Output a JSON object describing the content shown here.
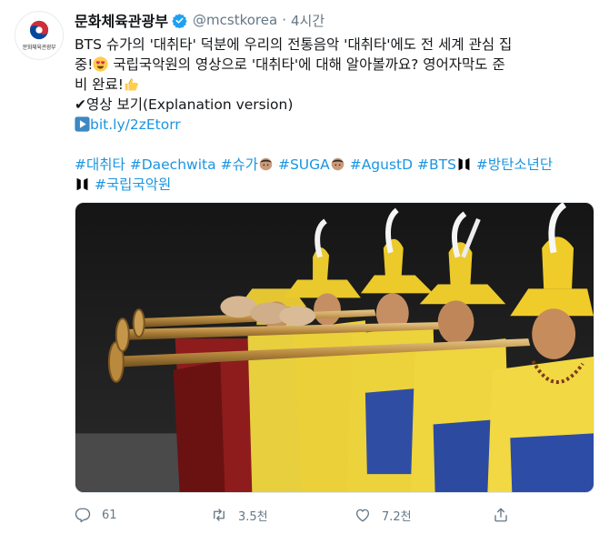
{
  "account": {
    "name": "문화체육관광부",
    "handle": "@mcstkorea",
    "separator": "·",
    "time": "4시간",
    "avatar_text": "문화체육관광부"
  },
  "tweet": {
    "line1": "BTS 슈가의 '대취타' 덕분에 우리의 전통음악 '대취타'에도 전 세계 관심 집",
    "line2a": "중!",
    "line2b": " 국립국악원의 영상으로 '대취타'에 대해 알아볼까요? 영어자막도 준",
    "line3": "비 완료!",
    "check_mark": "✔",
    "video_text": "영상 보기(Explanation version)",
    "link_text": "bit.ly/2zEtorr"
  },
  "hashtags": {
    "h1": "#대취타",
    "h2": "#Daechwita",
    "h3": "#슈가",
    "h4": "#SUGA",
    "h5": "#AgustD",
    "h6": "#BTS",
    "h7": "#방탄소년단",
    "h8": "#국립국악원"
  },
  "actions": {
    "reply_count": "61",
    "retweet_count": "3.5천",
    "like_count": "7.2천"
  },
  "icons": {
    "verified": "verified-badge-icon",
    "reply": "reply-icon",
    "retweet": "retweet-icon",
    "like": "heart-icon",
    "share": "share-icon"
  },
  "colors": {
    "link": "#1b95e0",
    "muted": "#657786",
    "text": "#14171a"
  }
}
